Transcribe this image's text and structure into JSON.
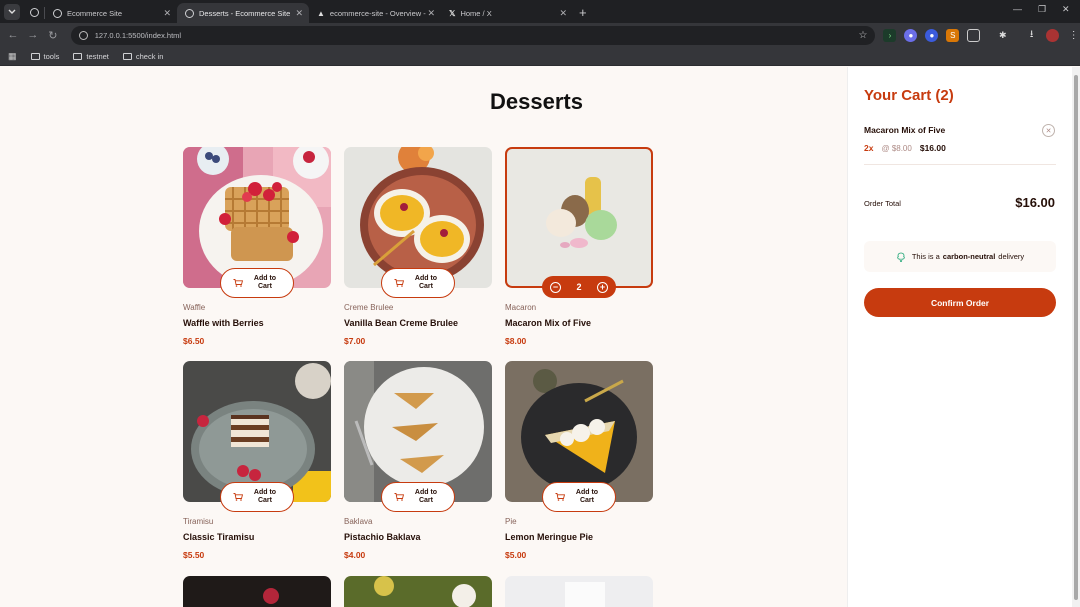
{
  "browser": {
    "tabs": [
      {
        "title": "Ecommerce Site"
      },
      {
        "title": "Desserts - Ecommerce Site"
      },
      {
        "title": "ecommerce-site - Overview - V"
      },
      {
        "title": "Home / X"
      }
    ],
    "url": "127.0.0.1:5500/index.html",
    "bookmarks": [
      "tools",
      "testnet",
      "check in"
    ]
  },
  "page": {
    "title": "Desserts",
    "add_to_cart_label": "Add to Cart",
    "products": [
      {
        "category": "Waffle",
        "name": "Waffle with Berries",
        "price": "$6.50"
      },
      {
        "category": "Creme Brulee",
        "name": "Vanilla Bean Creme Brulee",
        "price": "$7.00"
      },
      {
        "category": "Macaron",
        "name": "Macaron Mix of Five",
        "price": "$8.00",
        "quantity": "2"
      },
      {
        "category": "Tiramisu",
        "name": "Classic Tiramisu",
        "price": "$5.50"
      },
      {
        "category": "Baklava",
        "name": "Pistachio Baklava",
        "price": "$4.00"
      },
      {
        "category": "Pie",
        "name": "Lemon Meringue Pie",
        "price": "$5.00"
      }
    ]
  },
  "cart": {
    "title": "Your Cart (2)",
    "item": {
      "name": "Macaron Mix of Five",
      "qty": "2x",
      "unit": "@ $8.00",
      "total": "$16.00"
    },
    "order_label": "Order Total",
    "order_total": "$16.00",
    "neutral_pre": "This is a",
    "neutral_bold": "carbon-neutral",
    "neutral_post": "delivery",
    "confirm_label": "Confirm Order"
  },
  "colors": {
    "accent": "#c73b0f",
    "background": "#fcf8f5"
  }
}
